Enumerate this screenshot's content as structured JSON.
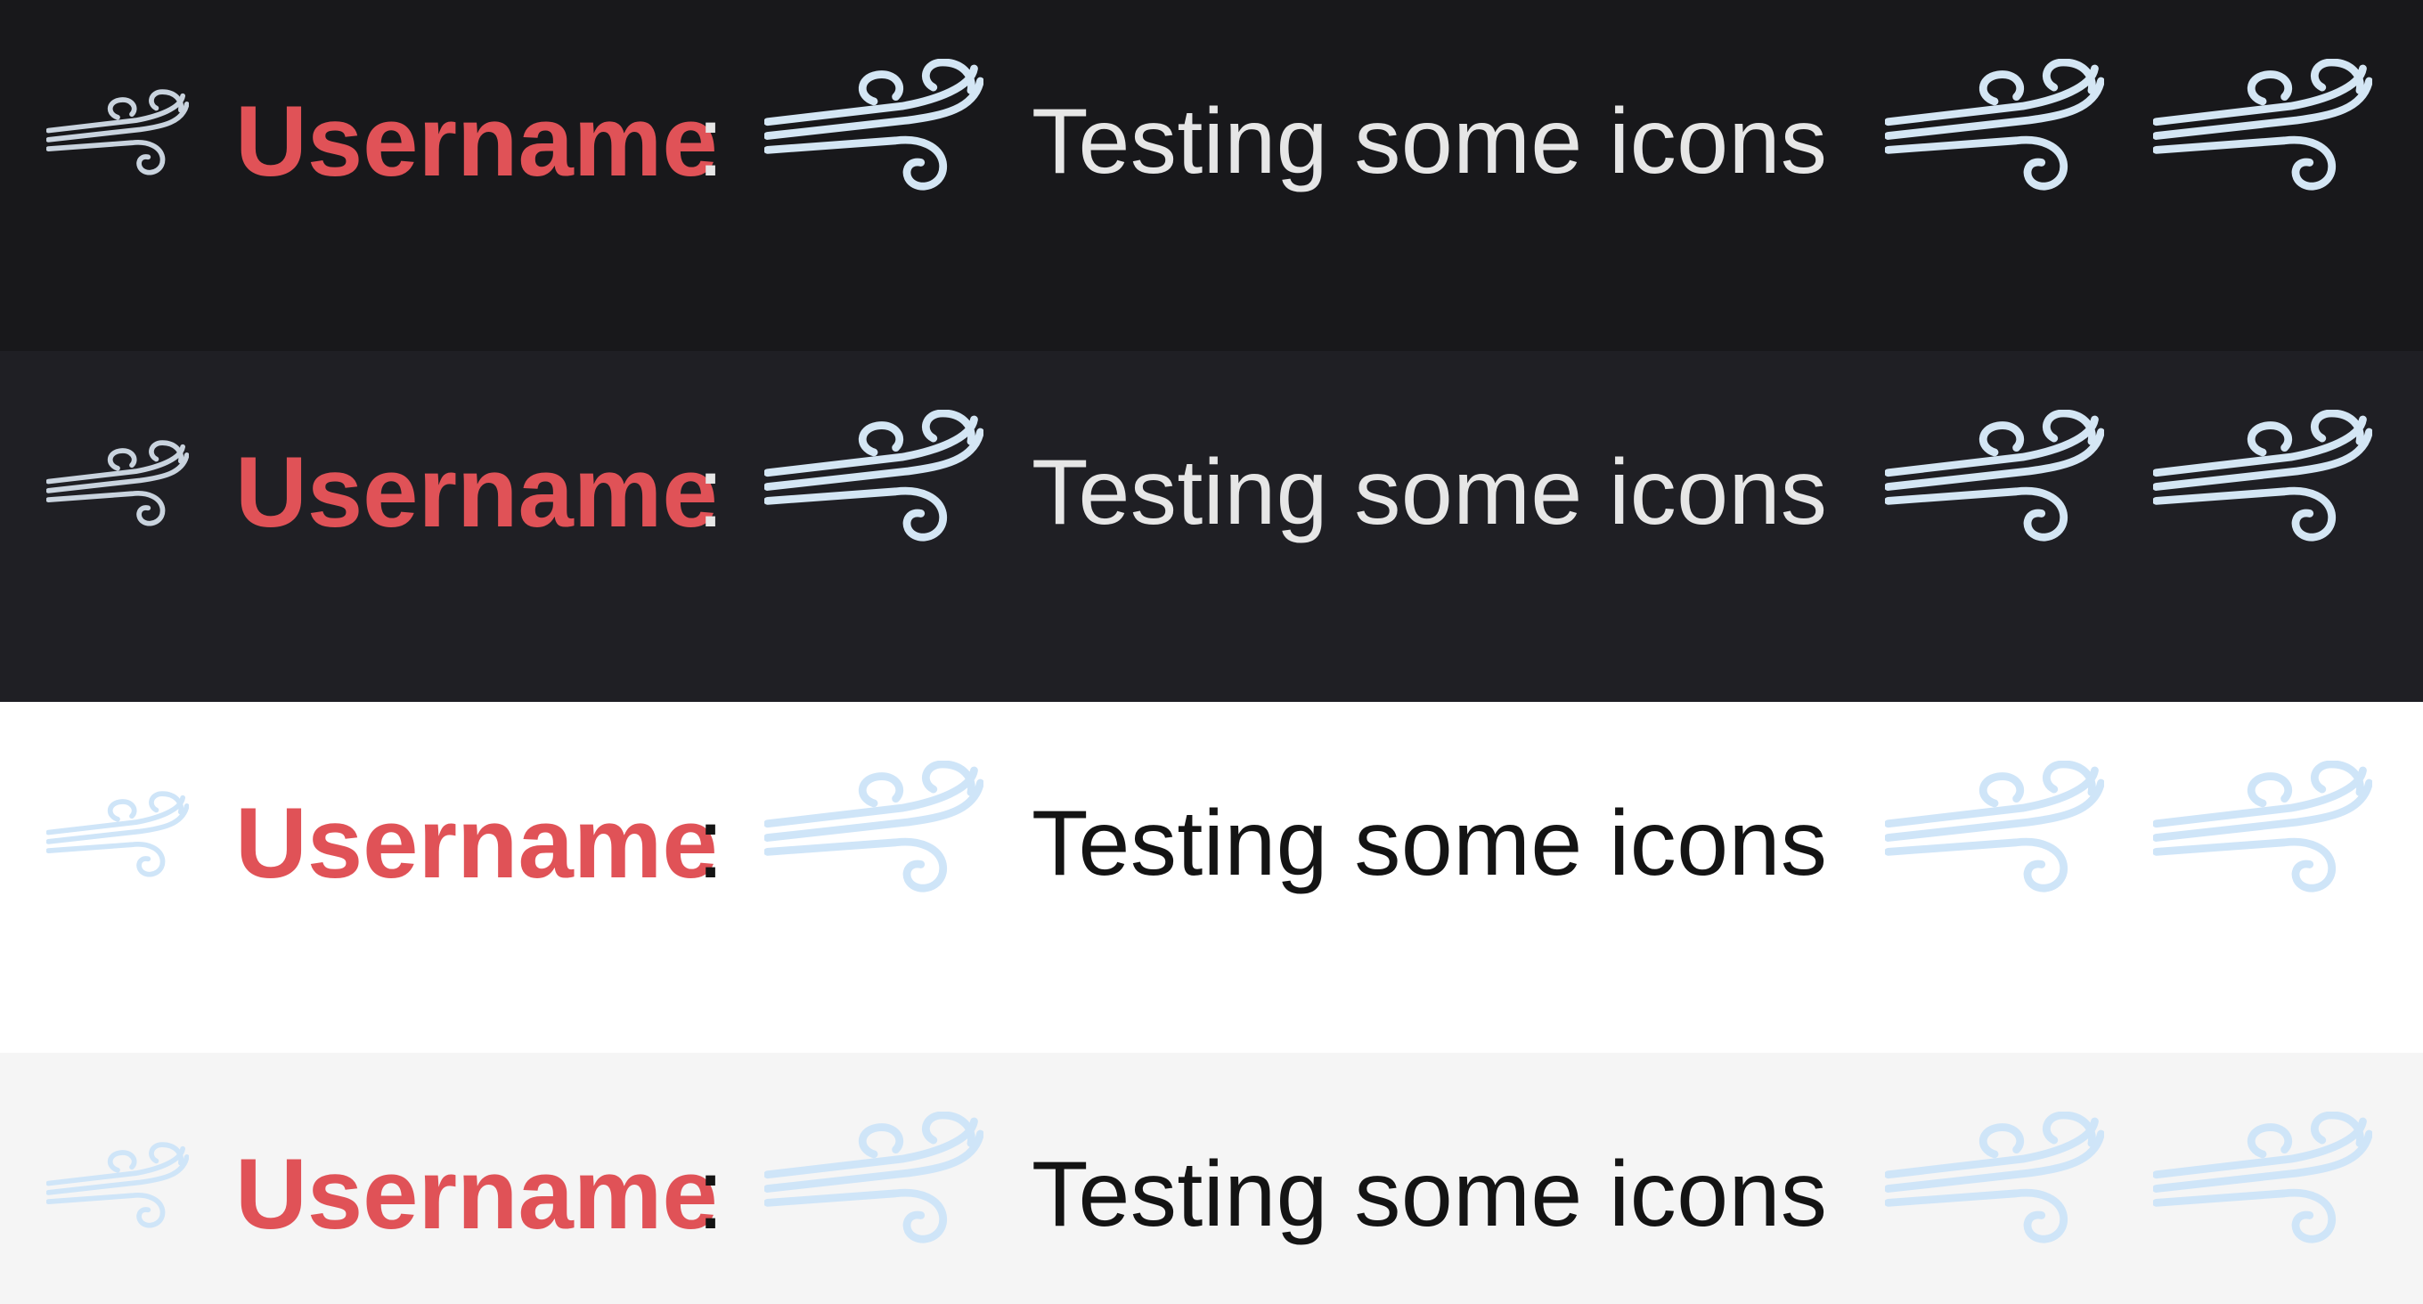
{
  "rows": [
    {
      "theme": "dark",
      "background": "#18181b",
      "username": "Username",
      "colon": ":",
      "message": "Testing some icons",
      "icon": "wind-icon"
    },
    {
      "theme": "dark",
      "background": "#1f1f24",
      "username": "Username",
      "colon": ":",
      "message": "Testing some icons",
      "icon": "wind-icon"
    },
    {
      "theme": "light",
      "background": "#ffffff",
      "username": "Username",
      "colon": ":",
      "message": "Testing some icons",
      "icon": "wind-icon"
    },
    {
      "theme": "light",
      "background": "#f5f5f5",
      "username": "Username",
      "colon": ":",
      "message": "Testing some icons",
      "icon": "wind-icon"
    }
  ],
  "colors": {
    "username": "#e05257",
    "text_dark_theme": "#e6e6e6",
    "text_light_theme": "#141414",
    "icon_dark_theme": "#d4e6f4",
    "icon_light_theme": "#cfe5f8"
  }
}
